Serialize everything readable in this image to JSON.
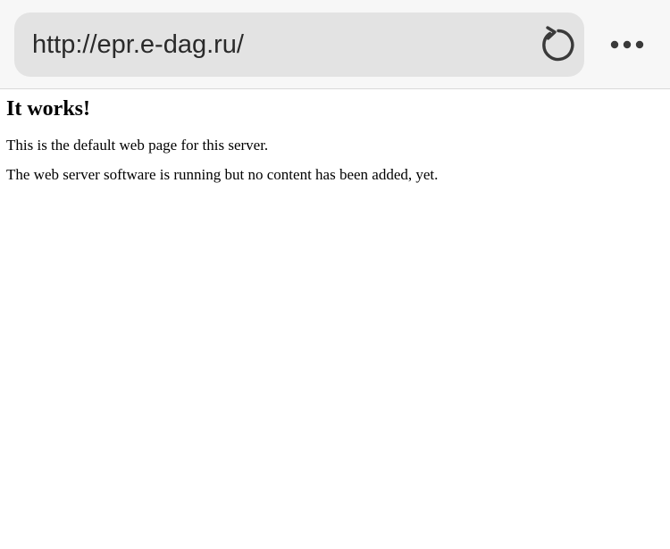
{
  "browser": {
    "url": "http://epr.e-dag.ru/",
    "reload_icon": "reload-icon",
    "more_icon": "more-horizontal-icon"
  },
  "page": {
    "title": "It works!",
    "paragraphs": [
      "This is the default web page for this server.",
      "The web server software is running but no content has been added, yet."
    ]
  }
}
